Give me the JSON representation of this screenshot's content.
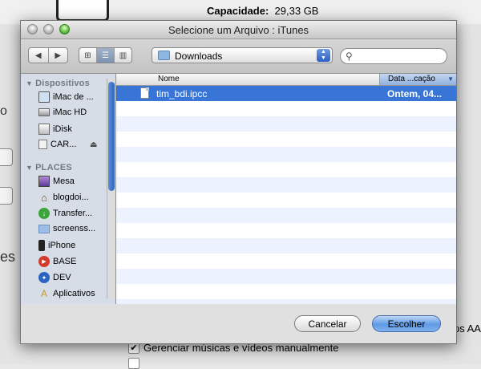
{
  "background": {
    "capacity_label": "Capacidade:",
    "capacity_value": "29,33 GB",
    "check_manual": "Gerenciar músicas e vídeos manualmente",
    "right_fragment": "ps AA"
  },
  "dialog": {
    "title": "Selecione um Arquivo : iTunes",
    "location": "Downloads",
    "search": {
      "value": "",
      "placeholder": ""
    },
    "view_modes": [
      "icon-view",
      "list-view",
      "column-view"
    ],
    "active_view": "list-view"
  },
  "sidebar": {
    "devices_header": "Dispositivos",
    "devices": [
      {
        "label": "iMac de ...",
        "icon": "imac-icon"
      },
      {
        "label": "iMac HD",
        "icon": "hard-drive-icon"
      },
      {
        "label": "iDisk",
        "icon": "idisk-icon"
      },
      {
        "label": "CAR...",
        "icon": "disk-icon"
      }
    ],
    "places_header": "PLACES",
    "places": [
      {
        "label": "Mesa",
        "icon": "desktop-icon"
      },
      {
        "label": "blogdoi...",
        "icon": "home-icon"
      },
      {
        "label": "Transfer...",
        "icon": "download-icon"
      },
      {
        "label": "screenss...",
        "icon": "folder-icon"
      },
      {
        "label": "iPhone",
        "icon": "iphone-icon"
      },
      {
        "label": "BASE",
        "icon": "record-icon"
      },
      {
        "label": "DEV",
        "icon": "compass-icon"
      },
      {
        "label": "Aplicativos",
        "icon": "applications-icon"
      }
    ]
  },
  "list": {
    "col_name": "Nome",
    "col_date": "Data ...cação",
    "files": [
      {
        "name": "tim_bdi.ipcc",
        "date": "Ontem, 04...",
        "selected": true
      }
    ]
  },
  "buttons": {
    "cancel": "Cancelar",
    "choose": "Escolher"
  },
  "colors": {
    "selection": "#3875d7",
    "alt_row": "#edf3fe",
    "sidebar_bg": "#d7dde6",
    "primary_button": "#5f9ae6"
  }
}
